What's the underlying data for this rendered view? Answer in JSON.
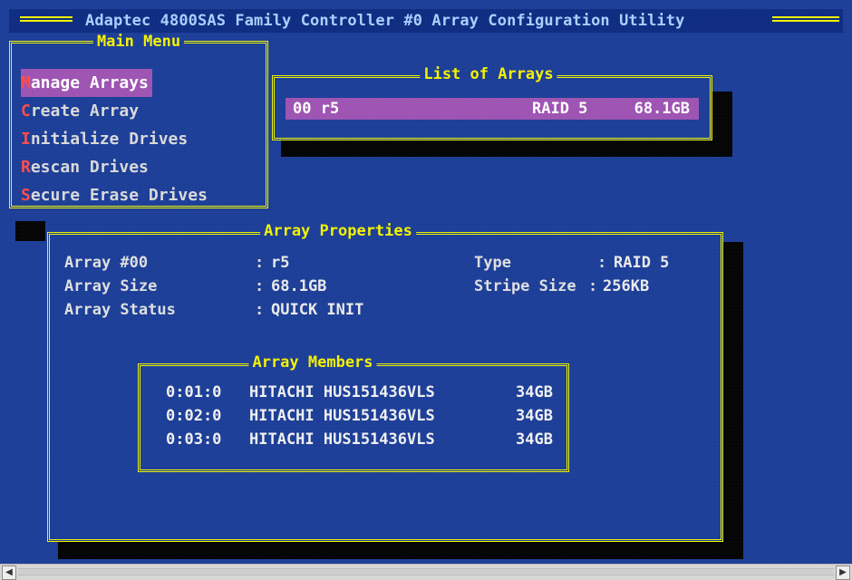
{
  "app": {
    "title": "Adaptec 4800SAS Family Controller #0 Array Configuration Utility"
  },
  "main_menu": {
    "title": "Main Menu",
    "items": [
      {
        "hotkey": "M",
        "rest": "anage Arrays"
      },
      {
        "hotkey": "C",
        "rest": "reate Array"
      },
      {
        "hotkey": "I",
        "rest": "nitialize Drives"
      },
      {
        "hotkey": "R",
        "rest": "escan Drives"
      },
      {
        "hotkey": "S",
        "rest": "ecure Erase Drives"
      }
    ]
  },
  "list_of_arrays": {
    "title": "List of Arrays",
    "selected": {
      "name": "00 r5",
      "raid": "RAID 5",
      "size": "68.1GB"
    }
  },
  "array_properties": {
    "title": "Array Properties",
    "rows": {
      "array_num_label": "Array #00",
      "array_num_value": "r5",
      "type_label": "Type",
      "type_value": "RAID 5",
      "array_size_label": "Array Size",
      "array_size_value": "68.1GB",
      "stripe_size_label": "Stripe Size",
      "stripe_size_value": "256KB",
      "array_status_label": "Array Status",
      "array_status_value": "QUICK INIT"
    }
  },
  "array_members": {
    "title": "Array Members",
    "rows": [
      {
        "slot": "0:01:0",
        "model": "HITACHI HUS151436VLS",
        "size": "34GB"
      },
      {
        "slot": "0:02:0",
        "model": "HITACHI HUS151436VLS",
        "size": "34GB"
      },
      {
        "slot": "0:03:0",
        "model": "HITACHI HUS151436VLS",
        "size": "34GB"
      }
    ]
  },
  "scrollbar": {
    "left_arrow_icon": "arrow-left-icon",
    "right_arrow_icon": "arrow-right-icon"
  },
  "colors": {
    "background": "#1d3f98",
    "title_text": "#a8d0ff",
    "frame": "#eef200",
    "highlight": "#9e54b2",
    "hotkey": "#ff4c4c",
    "text": "#d9d9d9"
  }
}
